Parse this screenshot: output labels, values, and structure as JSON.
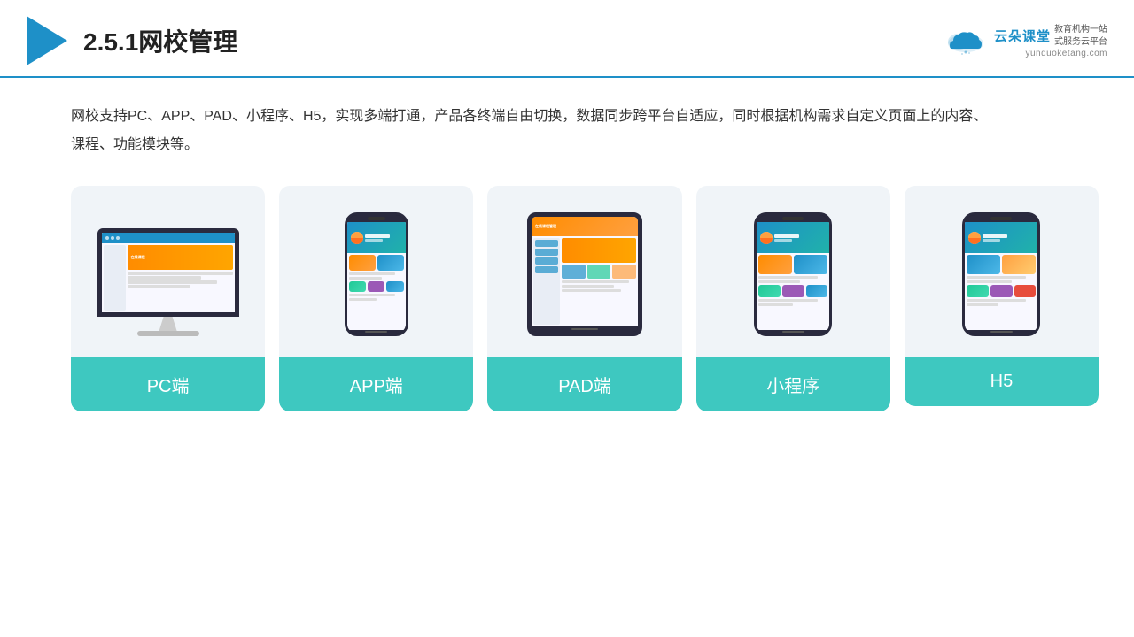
{
  "header": {
    "title": "2.5.1网校管理",
    "brand": {
      "name": "云朵课堂",
      "url": "yunduoketang.com",
      "subtitle_line1": "教育机构一站",
      "subtitle_line2": "式服务云平台"
    }
  },
  "description": {
    "text": "网校支持PC、APP、PAD、小程序、H5，实现多端打通，产品各终端自由切换，数据同步跨平台自适应，同时根据机构需求自定义页面上的内容、课程、功能模块等。"
  },
  "cards": [
    {
      "id": "pc",
      "label": "PC端"
    },
    {
      "id": "app",
      "label": "APP端"
    },
    {
      "id": "pad",
      "label": "PAD端"
    },
    {
      "id": "miniprogram",
      "label": "小程序"
    },
    {
      "id": "h5",
      "label": "H5"
    }
  ]
}
